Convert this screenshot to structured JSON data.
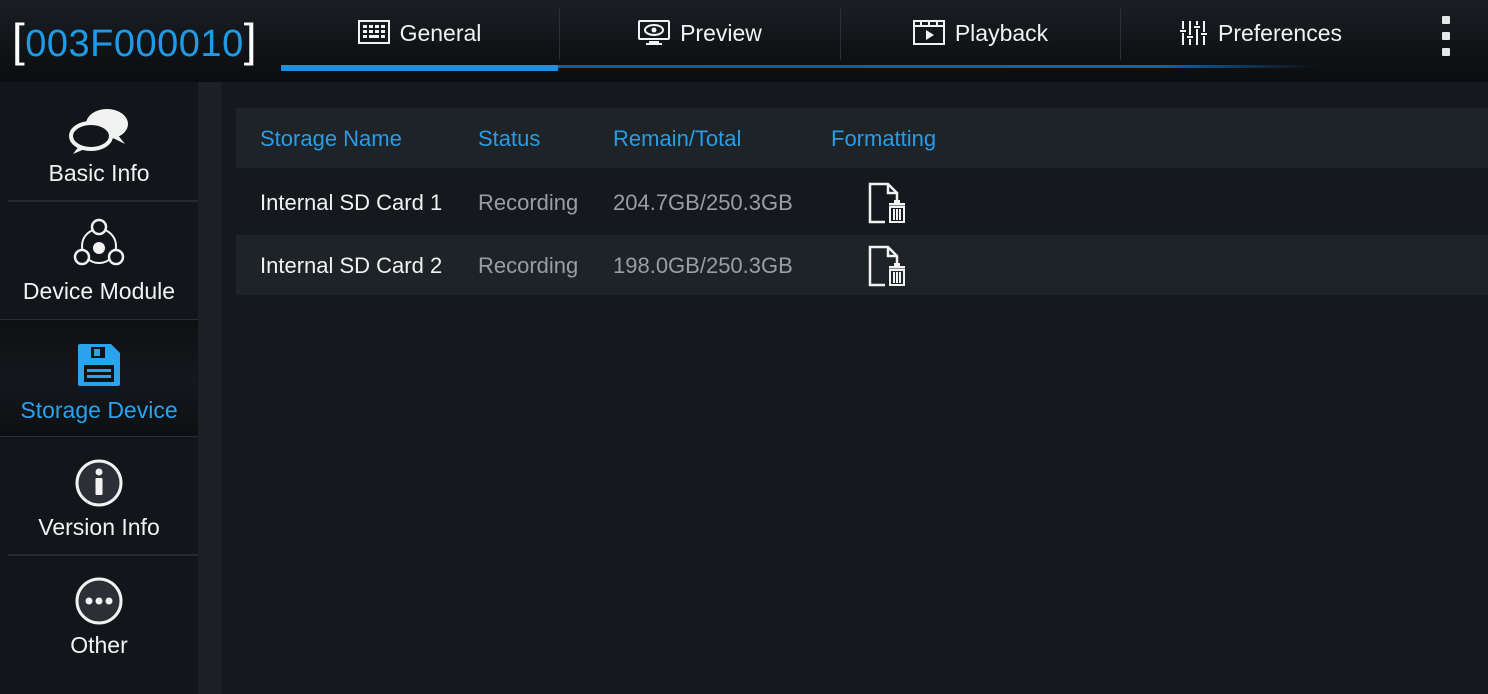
{
  "header": {
    "device_id_open": "[",
    "device_id": "003F000010",
    "device_id_close": "]",
    "tabs": [
      {
        "label": "General",
        "icon": "general-icon",
        "active": true
      },
      {
        "label": "Preview",
        "icon": "preview-icon",
        "active": false
      },
      {
        "label": "Playback",
        "icon": "playback-icon",
        "active": false
      },
      {
        "label": "Preferences",
        "icon": "preferences-icon",
        "active": false
      }
    ],
    "more_icon": "more-vertical-icon"
  },
  "sidebar": {
    "items": [
      {
        "label": "Basic Info",
        "icon": "chat-bubbles-icon",
        "active": false
      },
      {
        "label": "Device Module",
        "icon": "module-icon",
        "active": false
      },
      {
        "label": "Storage Device",
        "icon": "floppy-disk-icon",
        "active": true
      },
      {
        "label": "Version Info",
        "icon": "info-icon",
        "active": false
      },
      {
        "label": "Other",
        "icon": "more-horizontal-icon",
        "active": false
      }
    ]
  },
  "storage_table": {
    "columns": [
      "Storage Name",
      "Status",
      "Remain/Total",
      "Formatting"
    ],
    "rows": [
      {
        "name": "Internal SD Card 1",
        "status": "Recording",
        "remain_total": "204.7GB/250.3GB",
        "format_icon": "format-delete-icon"
      },
      {
        "name": "Internal SD Card 2",
        "status": "Recording",
        "remain_total": "198.0GB/250.3GB",
        "format_icon": "format-delete-icon"
      }
    ]
  },
  "colors": {
    "accent": "#1e9be8",
    "background": "#15181c",
    "row_alt": "#1e2328",
    "text": "#f2f2f2",
    "text_dim": "#9a9ea3"
  }
}
